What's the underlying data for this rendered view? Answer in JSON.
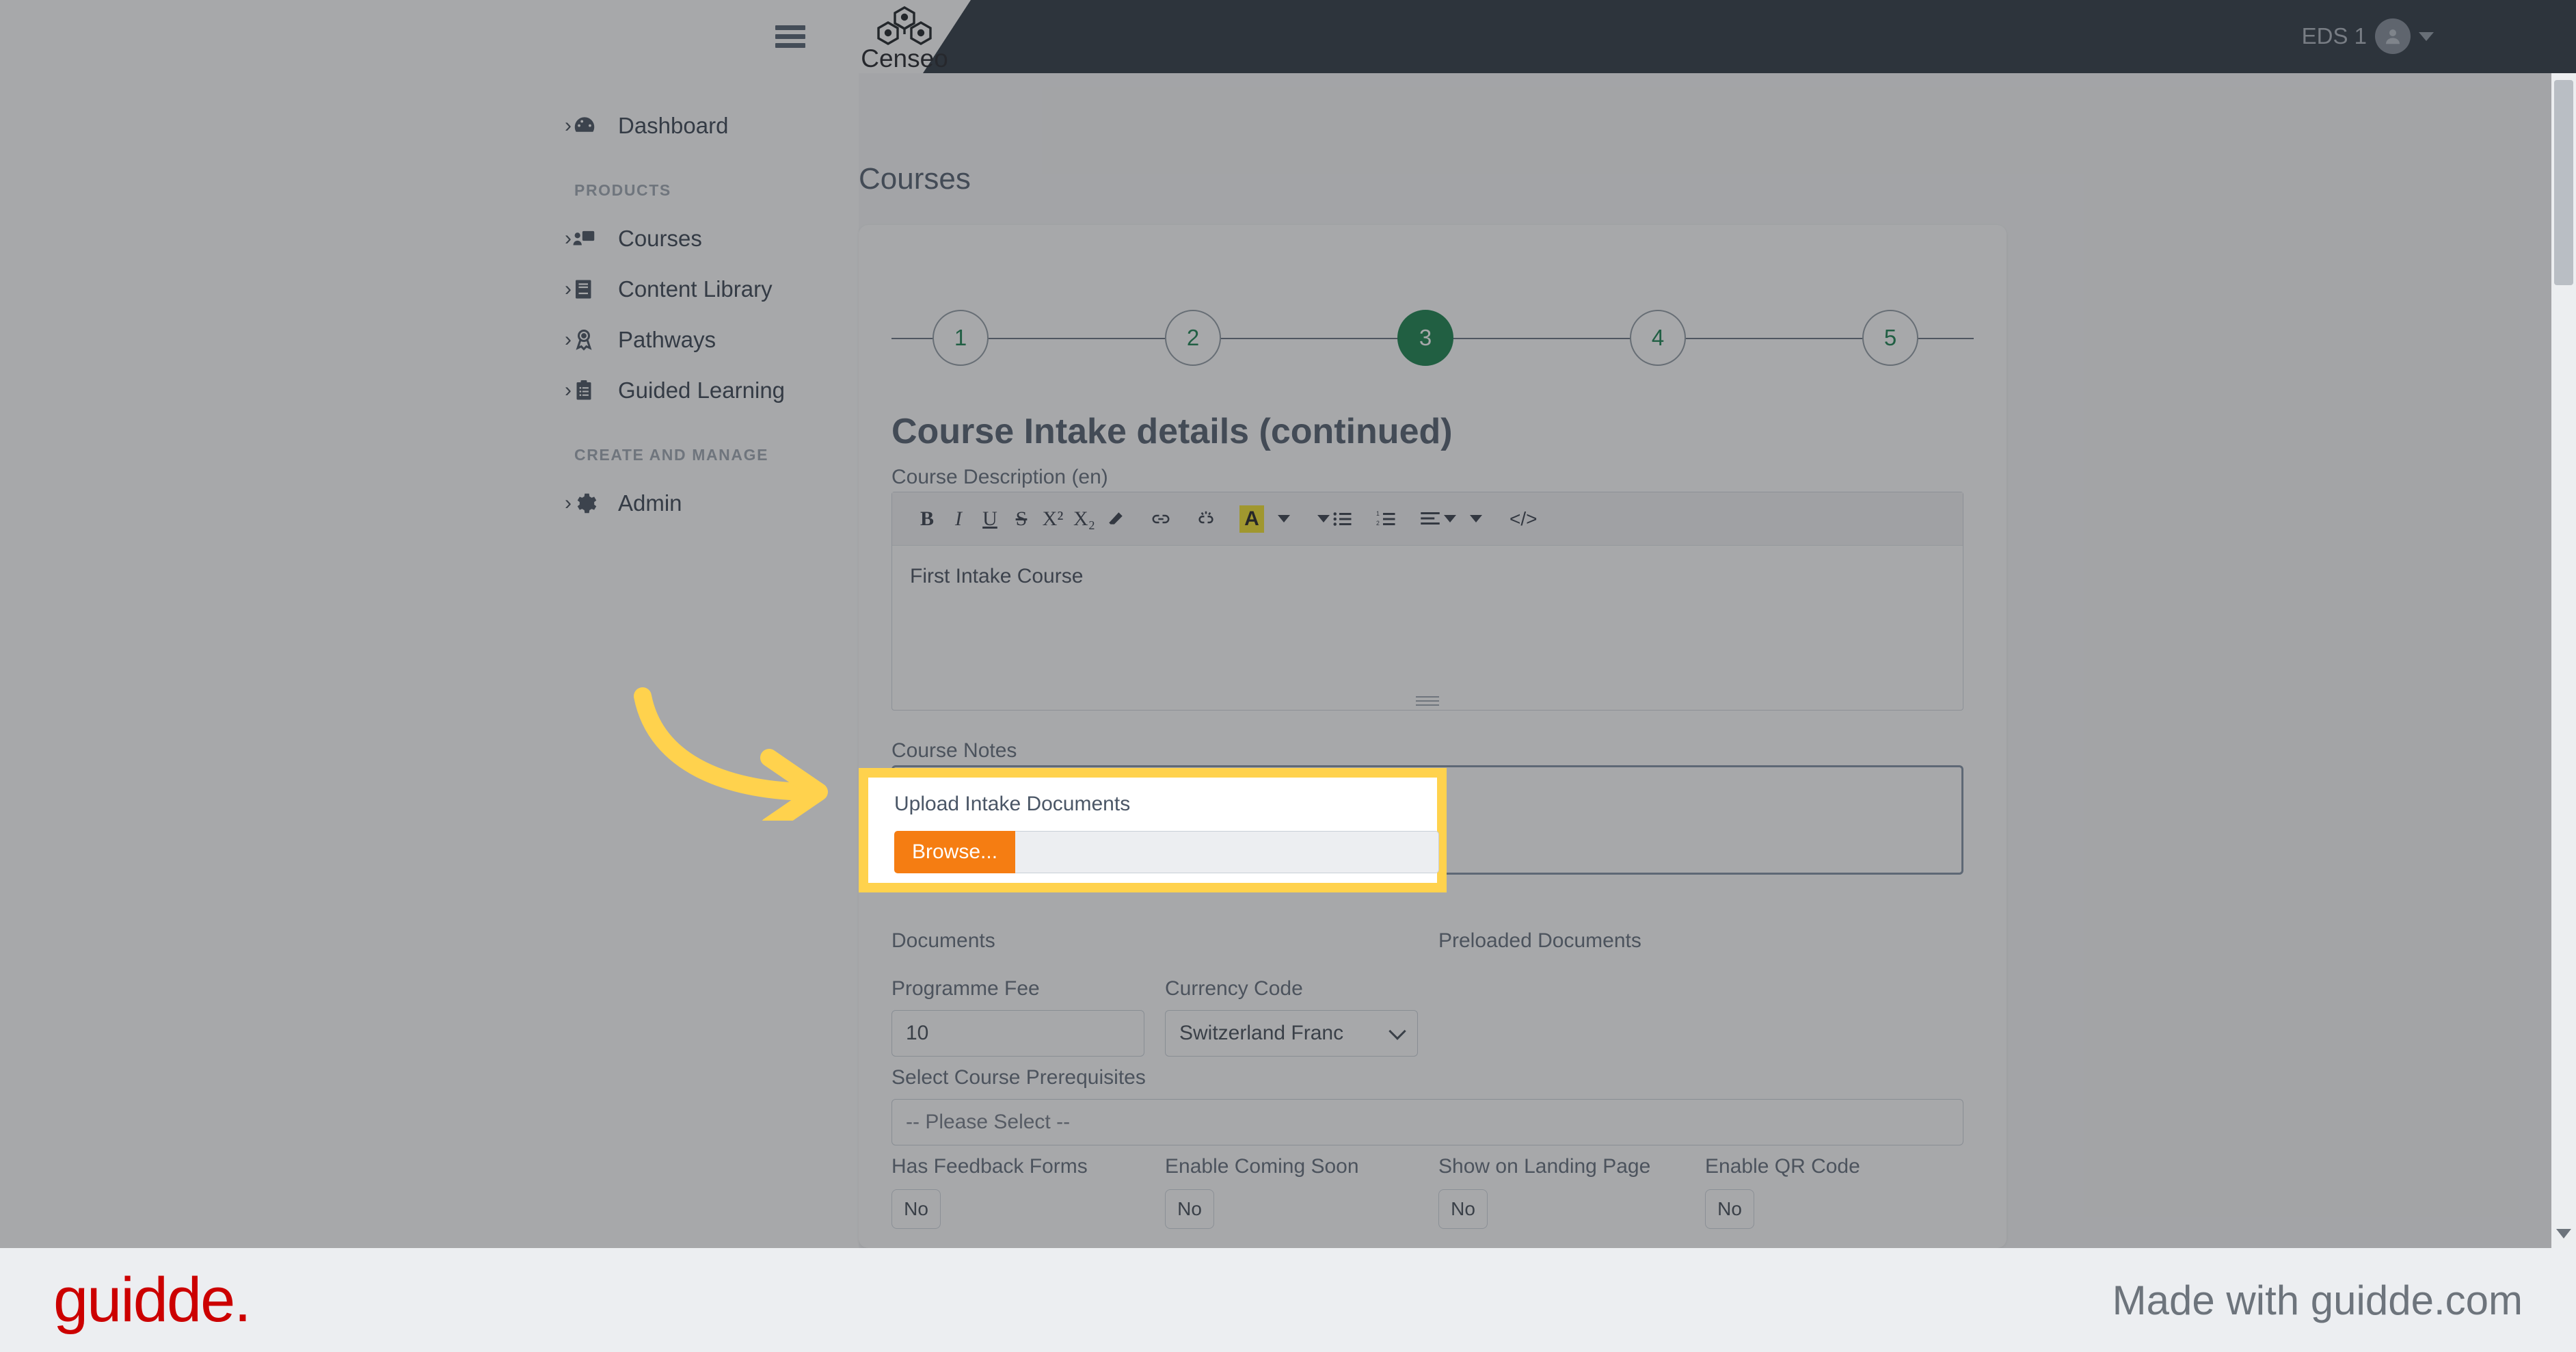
{
  "header": {
    "brand_name": "Censeo",
    "brand_icon": "censeo-hex-network-logo",
    "menu_icon": "hamburger-menu-icon",
    "user_name": "EDS 1",
    "avatar_icon": "user-avatar-icon",
    "caret_icon": "chevron-down-icon"
  },
  "sidebar": {
    "items": [
      {
        "label": "Dashboard",
        "icon": "dashboard-gauge-icon",
        "chevron": "›"
      },
      {
        "label": "Courses",
        "icon": "courses-presentation-icon",
        "chevron": "›"
      },
      {
        "label": "Content Library",
        "icon": "book-icon",
        "chevron": "›"
      },
      {
        "label": "Pathways",
        "icon": "award-ribbon-icon",
        "chevron": "›"
      },
      {
        "label": "Guided Learning",
        "icon": "clipboard-list-icon",
        "chevron": "›"
      },
      {
        "label": "Admin",
        "icon": "gear-icon",
        "chevron": "›"
      }
    ],
    "sections": {
      "products": "PRODUCTS",
      "create_and_manage": "CREATE AND MANAGE"
    }
  },
  "main": {
    "page_title": "Courses",
    "form_title": "Course Intake details (continued)",
    "stepper": {
      "steps": [
        "1",
        "2",
        "3",
        "4",
        "5"
      ],
      "active_index": 2,
      "active_color": "#0b7a43"
    },
    "course_description": {
      "label": "Course Description (en)",
      "value": "First Intake Course",
      "toolbar": [
        {
          "name": "bold-icon",
          "glyph": "B"
        },
        {
          "name": "italic-icon",
          "glyph": "I"
        },
        {
          "name": "underline-icon",
          "glyph": "U"
        },
        {
          "name": "strikethrough-icon",
          "glyph": "S"
        },
        {
          "name": "superscript-icon",
          "glyph": "X²"
        },
        {
          "name": "subscript-icon",
          "glyph": "X₂"
        },
        {
          "name": "eraser-icon",
          "glyph": "▮"
        },
        {
          "name": "link-icon",
          "glyph": "⚭"
        },
        {
          "name": "unlink-icon",
          "glyph": "⚮"
        },
        {
          "name": "text-color-icon",
          "glyph": "A"
        },
        {
          "name": "text-color-dropdown-icon",
          "glyph": "▾"
        },
        {
          "name": "bullet-list-icon",
          "glyph": "☰"
        },
        {
          "name": "numbered-list-icon",
          "glyph": "≡"
        },
        {
          "name": "align-icon",
          "glyph": "≡"
        },
        {
          "name": "align-dropdown-icon",
          "glyph": "▾"
        },
        {
          "name": "source-code-icon",
          "glyph": "</>"
        }
      ]
    },
    "course_notes": {
      "label": "Course Notes",
      "value": ""
    },
    "documents_label": "Documents",
    "preloaded_documents_label": "Preloaded Documents",
    "programme_fee": {
      "label": "Programme Fee",
      "value": "10"
    },
    "currency_code": {
      "label": "Currency Code",
      "value": "Switzerland Franc"
    },
    "course_prerequisites": {
      "label": "Select Course Prerequisites",
      "value": "-- Please Select --"
    },
    "toggles": [
      {
        "label": "Has Feedback Forms",
        "value": "No"
      },
      {
        "label": "Enable Coming Soon",
        "value": "No"
      },
      {
        "label": "Show on Landing Page",
        "value": "No"
      },
      {
        "label": "Enable QR Code",
        "value": "No"
      }
    ]
  },
  "callout": {
    "label": "Upload Intake Documents",
    "browse_button": "Browse...",
    "file_value": "",
    "highlight_color": "#ffd24d",
    "browse_color": "#f57d12",
    "arrow_icon": "curved-arrow-right-icon"
  },
  "footer": {
    "logo_text": "guidde.",
    "made_with": "Made with guidde.com",
    "logo_color": "#cc0000"
  }
}
